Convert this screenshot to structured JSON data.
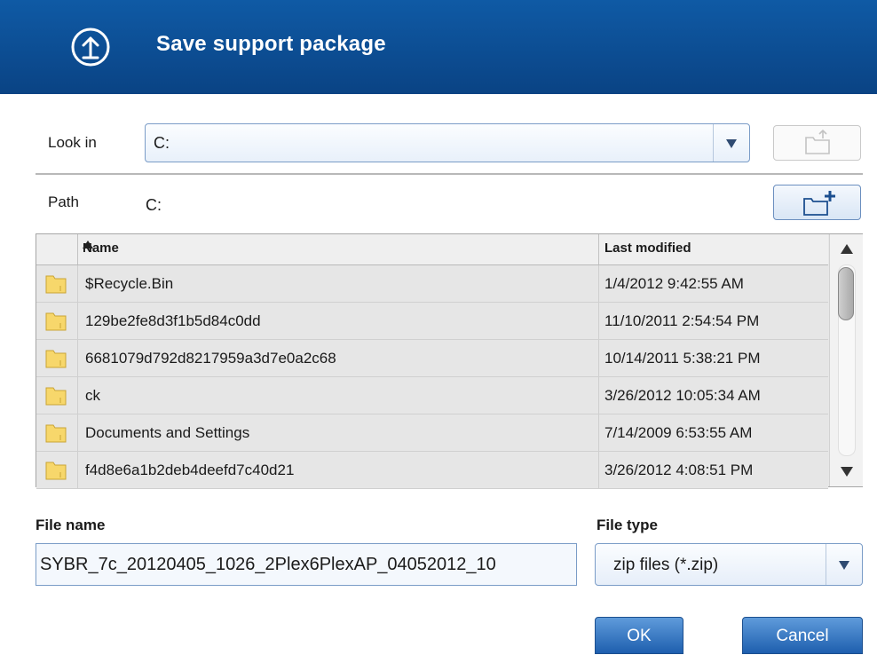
{
  "dialog": {
    "title": "Save support package",
    "icon": "upload-icon"
  },
  "look_in": {
    "label": "Look in",
    "value": "C:"
  },
  "path": {
    "label": "Path",
    "value": "C:"
  },
  "toolbar": {
    "up_folder_icon": "folder-up-icon",
    "new_folder_icon": "new-folder-icon"
  },
  "table": {
    "columns": {
      "name": "Name",
      "modified": "Last modified"
    },
    "sort": {
      "column": "name",
      "direction": "ascending"
    },
    "rows": [
      {
        "name": "$Recycle.Bin",
        "modified": "1/4/2012 9:42:55 AM"
      },
      {
        "name": "129be2fe8d3f1b5d84c0dd",
        "modified": "11/10/2011 2:54:54 PM"
      },
      {
        "name": "6681079d792d8217959a3d7e0a2c68",
        "modified": "10/14/2011 5:38:21 PM"
      },
      {
        "name": "ck",
        "modified": "3/26/2012 10:05:34 AM"
      },
      {
        "name": "Documents and Settings",
        "modified": "7/14/2009 6:53:55 AM"
      },
      {
        "name": "f4d8e6a1b2deb4deefd7c40d21",
        "modified": "3/26/2012 4:08:51 PM"
      }
    ]
  },
  "file_name": {
    "label": "File name",
    "value": "SYBR_7c_20120405_1026_2Plex6PlexAP_04052012_10"
  },
  "file_type": {
    "label": "File type",
    "value": "zip files (*.zip)"
  },
  "buttons": {
    "ok": "OK",
    "cancel": "Cancel"
  },
  "colors": {
    "titlebar": "#0a4384",
    "accent": "#1e5fae",
    "row_bg": "#e6e6e6"
  }
}
